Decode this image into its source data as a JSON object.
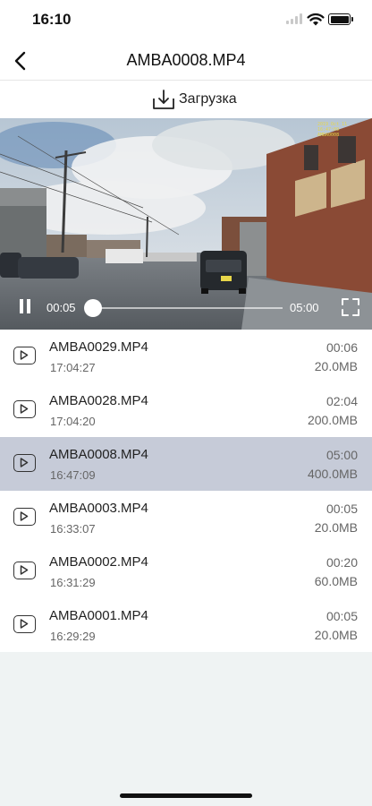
{
  "status_bar": {
    "time": "16:10",
    "battery_level": 1.0
  },
  "header": {
    "title": "AMBA0008.MP4"
  },
  "toolbar": {
    "download_label": "Загрузка"
  },
  "player": {
    "current_time": "00:05",
    "total_time": "05:00",
    "progress": 0.017,
    "stamp": "2019 Oct 11\n16:47:09\nAMBA0008"
  },
  "files": [
    {
      "name": "AMBA0029.MP4",
      "time": "17:04:27",
      "duration": "00:06",
      "size": "20.0MB",
      "selected": false
    },
    {
      "name": "AMBA0028.MP4",
      "time": "17:04:20",
      "duration": "02:04",
      "size": "200.0MB",
      "selected": false
    },
    {
      "name": "AMBA0008.MP4",
      "time": "16:47:09",
      "duration": "05:00",
      "size": "400.0MB",
      "selected": true
    },
    {
      "name": "AMBA0003.MP4",
      "time": "16:33:07",
      "duration": "00:05",
      "size": "20.0MB",
      "selected": false
    },
    {
      "name": "AMBA0002.MP4",
      "time": "16:31:29",
      "duration": "00:20",
      "size": "60.0MB",
      "selected": false
    },
    {
      "name": "AMBA0001.MP4",
      "time": "16:29:29",
      "duration": "00:05",
      "size": "20.0MB",
      "selected": false
    }
  ],
  "colors": {
    "selected_row": "#c6cbd8",
    "background": "#eff3f3"
  }
}
